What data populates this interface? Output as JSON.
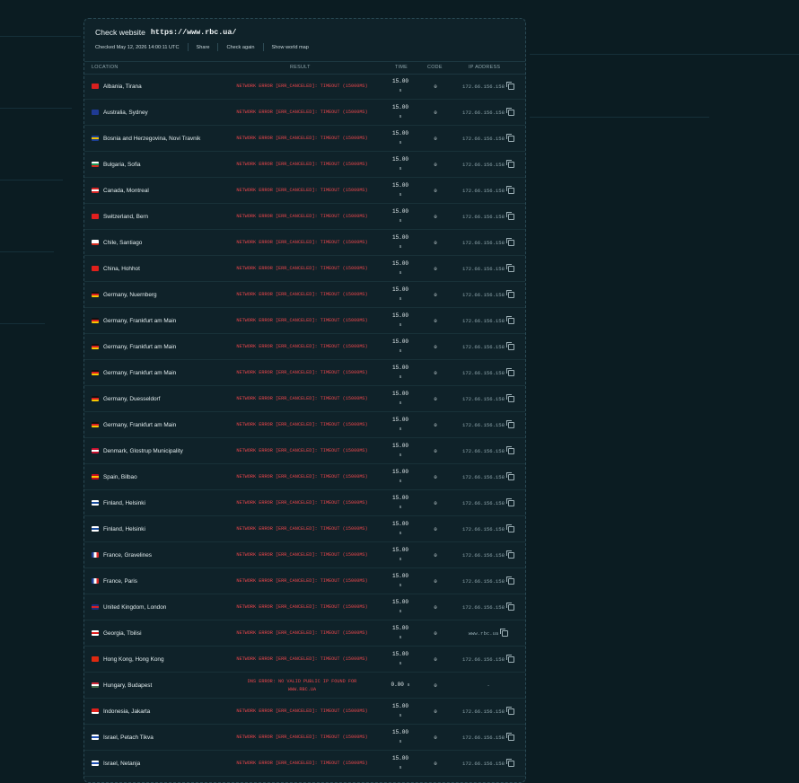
{
  "header": {
    "title": "Check website",
    "url": "https://www.rbc.ua/",
    "checked": "Checked May 12, 2026 14:00:11 UTC",
    "share": "Share",
    "check_again": "Check again",
    "world_map": "Show world map"
  },
  "columns": {
    "location": "LOCATION",
    "result": "RESULT",
    "time": "TIME",
    "code": "CODE",
    "ip": "IP ADDRESS"
  },
  "error_text": "NETWORK ERROR [ERR_CANCELED]: TIMEOUT (15000MS)",
  "rows": [
    {
      "location": "Albania, Tirana",
      "flag": [
        "#d9201f",
        "#d9201f",
        "#d9201f"
      ],
      "result": "NETWORK ERROR [ERR_CANCELED]: TIMEOUT (15000MS)",
      "time": "15.00",
      "unit": "s",
      "code": "0",
      "ip": "172.66.156.158"
    },
    {
      "location": "Australia, Sydney",
      "flag": [
        "#1f3a93",
        "#1f3a93",
        "#1f3a93"
      ],
      "result": "NETWORK ERROR [ERR_CANCELED]: TIMEOUT (15000MS)",
      "time": "15.00",
      "unit": "s",
      "code": "0",
      "ip": "172.66.156.158"
    },
    {
      "location": "Bosnia and Herzegovina, Novi Travnik",
      "flag": [
        "#1b3e94",
        "#f2c200",
        "#1b3e94"
      ],
      "result": "NETWORK ERROR [ERR_CANCELED]: TIMEOUT (15000MS)",
      "time": "15.00",
      "unit": "s",
      "code": "0",
      "ip": "172.66.156.158"
    },
    {
      "location": "Bulgaria, Sofia",
      "flag": [
        "#ffffff",
        "#1a9a5c",
        "#d6261c"
      ],
      "result": "NETWORK ERROR [ERR_CANCELED]: TIMEOUT (15000MS)",
      "time": "15.00",
      "unit": "s",
      "code": "0",
      "ip": "172.66.156.158"
    },
    {
      "location": "Canada, Montreal",
      "flag": [
        "#d82424",
        "#ffffff",
        "#d82424"
      ],
      "result": "NETWORK ERROR [ERR_CANCELED]: TIMEOUT (15000MS)",
      "time": "15.00",
      "unit": "s",
      "code": "0",
      "ip": "172.66.156.158"
    },
    {
      "location": "Switzerland, Bern",
      "flag": [
        "#e01e1e",
        "#e01e1e",
        "#e01e1e"
      ],
      "result": "NETWORK ERROR [ERR_CANCELED]: TIMEOUT (15000MS)",
      "time": "15.00",
      "unit": "s",
      "code": "0",
      "ip": "172.66.156.158"
    },
    {
      "location": "Chile, Santiago",
      "flag": [
        "#ffffff",
        "#ffffff",
        "#d52b1e"
      ],
      "result": "NETWORK ERROR [ERR_CANCELED]: TIMEOUT (15000MS)",
      "time": "15.00",
      "unit": "s",
      "code": "0",
      "ip": "172.66.156.158"
    },
    {
      "location": "China, Hohhot",
      "flag": [
        "#e0201b",
        "#e0201b",
        "#e0201b"
      ],
      "result": "NETWORK ERROR [ERR_CANCELED]: TIMEOUT (15000MS)",
      "time": "15.00",
      "unit": "s",
      "code": "0",
      "ip": "172.66.156.158"
    },
    {
      "location": "Germany, Nuernberg",
      "flag": [
        "#111111",
        "#dd1f1f",
        "#f7c800"
      ],
      "result": "NETWORK ERROR [ERR_CANCELED]: TIMEOUT (15000MS)",
      "time": "15.00",
      "unit": "s",
      "code": "0",
      "ip": "172.66.156.158"
    },
    {
      "location": "Germany, Frankfurt am Main",
      "flag": [
        "#111111",
        "#dd1f1f",
        "#f7c800"
      ],
      "result": "NETWORK ERROR [ERR_CANCELED]: TIMEOUT (15000MS)",
      "time": "15.00",
      "unit": "s",
      "code": "0",
      "ip": "172.66.156.158"
    },
    {
      "location": "Germany, Frankfurt am Main",
      "flag": [
        "#111111",
        "#dd1f1f",
        "#f7c800"
      ],
      "result": "NETWORK ERROR [ERR_CANCELED]: TIMEOUT (15000MS)",
      "time": "15.00",
      "unit": "s",
      "code": "0",
      "ip": "172.66.156.158"
    },
    {
      "location": "Germany, Frankfurt am Main",
      "flag": [
        "#111111",
        "#dd1f1f",
        "#f7c800"
      ],
      "result": "NETWORK ERROR [ERR_CANCELED]: TIMEOUT (15000MS)",
      "time": "15.00",
      "unit": "s",
      "code": "0",
      "ip": "172.66.156.158"
    },
    {
      "location": "Germany, Duesseldorf",
      "flag": [
        "#111111",
        "#dd1f1f",
        "#f7c800"
      ],
      "result": "NETWORK ERROR [ERR_CANCELED]: TIMEOUT (15000MS)",
      "time": "15.00",
      "unit": "s",
      "code": "0",
      "ip": "172.66.156.158"
    },
    {
      "location": "Germany, Frankfurt am Main",
      "flag": [
        "#111111",
        "#dd1f1f",
        "#f7c800"
      ],
      "result": "NETWORK ERROR [ERR_CANCELED]: TIMEOUT (15000MS)",
      "time": "15.00",
      "unit": "s",
      "code": "0",
      "ip": "172.66.156.158"
    },
    {
      "location": "Denmark, Glostrup Municipality",
      "flag": [
        "#c8102e",
        "#ffffff",
        "#c8102e"
      ],
      "result": "NETWORK ERROR [ERR_CANCELED]: TIMEOUT (15000MS)",
      "time": "15.00",
      "unit": "s",
      "code": "0",
      "ip": "172.66.156.158"
    },
    {
      "location": "Spain, Bilbao",
      "flag": [
        "#c60b1e",
        "#ffc400",
        "#c60b1e"
      ],
      "result": "NETWORK ERROR [ERR_CANCELED]: TIMEOUT (15000MS)",
      "time": "15.00",
      "unit": "s",
      "code": "0",
      "ip": "172.66.156.158"
    },
    {
      "location": "Finland, Helsinki",
      "flag": [
        "#ffffff",
        "#1a4ea0",
        "#ffffff"
      ],
      "result": "NETWORK ERROR [ERR_CANCELED]: TIMEOUT (15000MS)",
      "time": "15.00",
      "unit": "s",
      "code": "0",
      "ip": "172.66.156.158"
    },
    {
      "location": "Finland, Helsinki",
      "flag": [
        "#ffffff",
        "#1a4ea0",
        "#ffffff"
      ],
      "result": "NETWORK ERROR [ERR_CANCELED]: TIMEOUT (15000MS)",
      "time": "15.00",
      "unit": "s",
      "code": "0",
      "ip": "172.66.156.158"
    },
    {
      "location": "France, Gravelines",
      "flag": [
        "#1f3f9a",
        "#ffffff",
        "#e02a2a"
      ],
      "vertical": true,
      "result": "NETWORK ERROR [ERR_CANCELED]: TIMEOUT (15000MS)",
      "time": "15.00",
      "unit": "s",
      "code": "0",
      "ip": "172.66.156.158"
    },
    {
      "location": "France, Paris",
      "flag": [
        "#1f3f9a",
        "#ffffff",
        "#e02a2a"
      ],
      "vertical": true,
      "result": "NETWORK ERROR [ERR_CANCELED]: TIMEOUT (15000MS)",
      "time": "15.00",
      "unit": "s",
      "code": "0",
      "ip": "172.66.156.158"
    },
    {
      "location": "United Kingdom, London",
      "flag": [
        "#1f2f7a",
        "#d92027",
        "#1f2f7a"
      ],
      "result": "NETWORK ERROR [ERR_CANCELED]: TIMEOUT (15000MS)",
      "time": "15.00",
      "unit": "s",
      "code": "0",
      "ip": "172.66.156.158"
    },
    {
      "location": "Georgia, Tbilisi",
      "flag": [
        "#ffffff",
        "#e01e1e",
        "#ffffff"
      ],
      "result": "NETWORK ERROR [ERR_CANCELED]: TIMEOUT (15000MS)",
      "time": "15.00",
      "unit": "s",
      "code": "0",
      "ip": "www.rbc.ua"
    },
    {
      "location": "Hong Kong, Hong Kong",
      "flag": [
        "#de2910",
        "#de2910",
        "#de2910"
      ],
      "result": "NETWORK ERROR [ERR_CANCELED]: TIMEOUT (15000MS)",
      "time": "15.00",
      "unit": "s",
      "code": "0",
      "ip": "172.66.156.158"
    },
    {
      "location": "Hungary, Budapest",
      "flag": [
        "#ce2939",
        "#ffffff",
        "#477050"
      ],
      "result": "DNS ERROR: NO VALID PUBLIC IP FOUND FOR WWW.RBC.UA",
      "time": "0.00",
      "unit": "s",
      "code": "0",
      "ip": "-",
      "inline_time": true,
      "no_copy": true
    },
    {
      "location": "Indonesia, Jakarta",
      "flag": [
        "#e0201b",
        "#e0201b",
        "#ffffff"
      ],
      "result": "NETWORK ERROR [ERR_CANCELED]: TIMEOUT (15000MS)",
      "time": "15.00",
      "unit": "s",
      "code": "0",
      "ip": "172.66.156.158"
    },
    {
      "location": "Israel, Petach Tikva",
      "flag": [
        "#ffffff",
        "#1e4fb3",
        "#ffffff"
      ],
      "result": "NETWORK ERROR [ERR_CANCELED]: TIMEOUT (15000MS)",
      "time": "15.00",
      "unit": "s",
      "code": "0",
      "ip": "172.66.156.158"
    },
    {
      "location": "Israel, Netanja",
      "flag": [
        "#ffffff",
        "#1e4fb3",
        "#ffffff"
      ],
      "result": "NETWORK ERROR [ERR_CANCELED]: TIMEOUT (15000MS)",
      "time": "15.00",
      "unit": "s",
      "code": "0",
      "ip": "172.66.156.158"
    }
  ]
}
